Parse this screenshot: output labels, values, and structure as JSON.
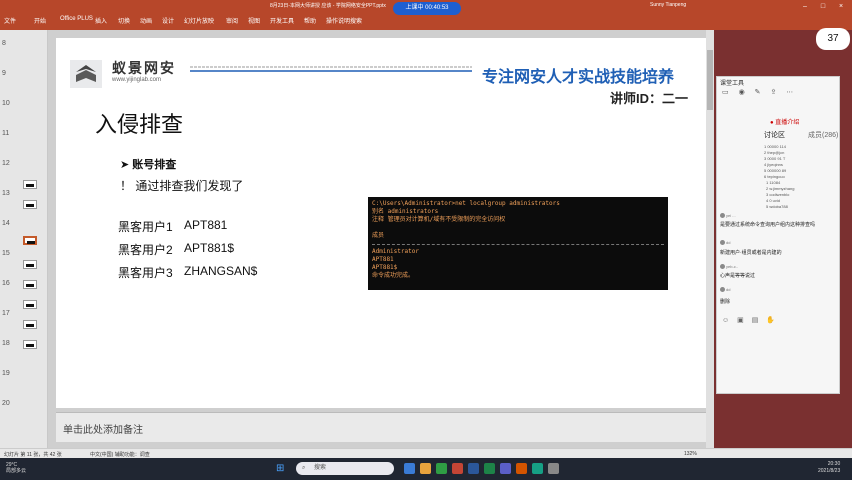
{
  "titlebar": {
    "title": "8月23日-本网大师讲授 应该 - 学院网络安全PPT.pptx"
  },
  "ribbon": {
    "menus": [
      "文件",
      "开始",
      "Office PLUS",
      "插入",
      "切换",
      "动画",
      "设计",
      "幻灯片放映",
      "审阅",
      "视图",
      "开发工具",
      "帮助",
      "操作说明搜索"
    ],
    "meeting": "上课中 00:40:53",
    "user": "Sunny Tianpeng"
  },
  "thumbs": {
    "numbers": [
      "8",
      "9",
      "10",
      "11",
      "12",
      "13",
      "14",
      "15",
      "16",
      "17",
      "18",
      "19",
      "20"
    ]
  },
  "slide": {
    "logo_name": "蚁景网安",
    "logo_url": "www.yijinglab.com",
    "slogan": "专注网安人才实战技能培养",
    "lecturer": "讲师ID：二一",
    "title": "入侵排查",
    "bullet1": "账号排查",
    "bullet2": "！  通过排查我们发现了",
    "hackers": [
      {
        "label": "黑客用户1",
        "value": "APT881"
      },
      {
        "label": "黑客用户2",
        "value": "APT881$"
      },
      {
        "label": "黑客用户3",
        "value": "ZHANGSAN$"
      }
    ],
    "terminal": {
      "lines_top": [
        "C:\\Users\\Administrator>net localgroup administrators",
        "别名    administrators",
        "注释    管理员对计算机/域有不受限制的完全访问权",
        "",
        "成员"
      ],
      "lines_bottom": [
        "Administrator",
        "APT881",
        "APT881$",
        "命令成功完成。"
      ]
    },
    "notes_placeholder": "单击此处添加备注"
  },
  "statusbar": {
    "left": "幻灯片 第 11 张，共 42 张",
    "middle": "中文(中国)   辅助功能：调查",
    "zoom": "132%"
  },
  "right": {
    "zoom_badge": "37",
    "chat_title": "课堂工具",
    "tab_live": "● 直播介绍",
    "tab_discussion": "讨论区",
    "tab_members": "成员(286)",
    "list_items": [
      "1 00000 114",
      "2 thep@jcn",
      "3 0000 91 T",
      "4 jiyeqinns",
      "5 000000 89",
      "6 tepingcuo",
      "1 11084",
      "2 w.jimmyzhang",
      "3 codiwenblo",
      "4 0 uvid",
      "5 wdoba788"
    ],
    "messages": [
      {
        "user": "yei ...",
        "text": "是要通过系统命令查询用户组内这种排查吗"
      },
      {
        "user": "dd",
        "text": "新建用户·组员或者是内建的"
      },
      {
        "user": "yeb-c..",
        "text": "心声是等等说过"
      },
      {
        "user": "dd",
        "text": "删除"
      }
    ]
  },
  "taskbar": {
    "weather_temp": "29°C",
    "weather_desc": "局部多云",
    "search_placeholder": "搜索",
    "time": "20:30",
    "date": "2021/8/23"
  },
  "colors": {
    "ribbon": "#b7472a",
    "slogan": "#1f5fb5",
    "terminal_bg": "#0c0c0c",
    "terminal_fg": "#f0a05a"
  }
}
